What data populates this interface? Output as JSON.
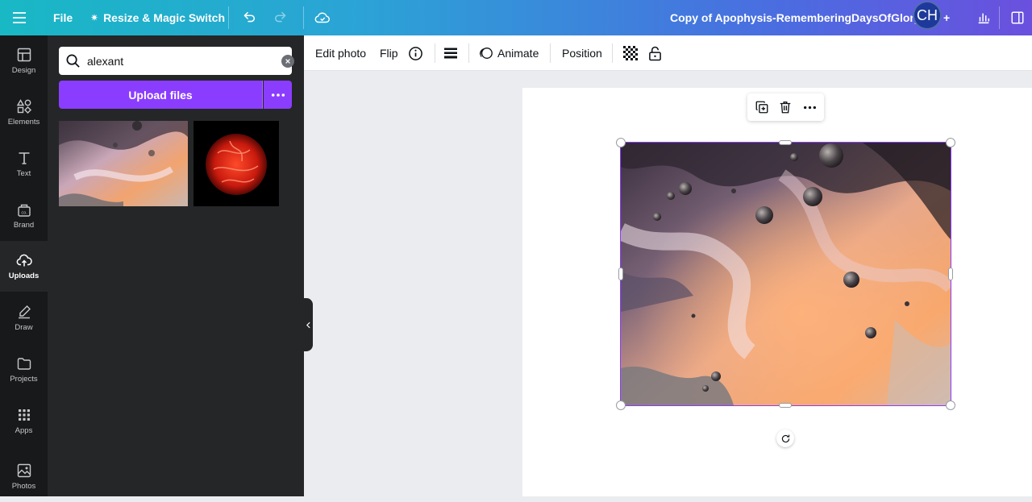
{
  "topbar": {
    "file_label": "File",
    "resize_label": "Resize & Magic Switch",
    "document_title": "Copy of Apophysis-RememberingDaysOfGlory",
    "avatar_initials": "CH",
    "gradient_colors": [
      "#19b8c5",
      "#6a50de"
    ]
  },
  "rail": {
    "items": [
      {
        "label": "Design",
        "icon": "layout-icon"
      },
      {
        "label": "Elements",
        "icon": "shapes-icon"
      },
      {
        "label": "Text",
        "icon": "text-icon"
      },
      {
        "label": "Brand",
        "icon": "brand-kit-icon"
      },
      {
        "label": "Uploads",
        "icon": "cloud-upload-icon",
        "active": true
      },
      {
        "label": "Draw",
        "icon": "pen-icon"
      },
      {
        "label": "Projects",
        "icon": "folder-icon"
      },
      {
        "label": "Apps",
        "icon": "grid-icon"
      },
      {
        "label": "Photos",
        "icon": "image-icon"
      }
    ]
  },
  "side_panel": {
    "search": {
      "value": "alexant"
    },
    "upload_label": "Upload files",
    "accent_color": "#8b3dff"
  },
  "context_toolbar": {
    "edit_photo": "Edit photo",
    "flip": "Flip",
    "animate": "Animate",
    "position": "Position"
  }
}
